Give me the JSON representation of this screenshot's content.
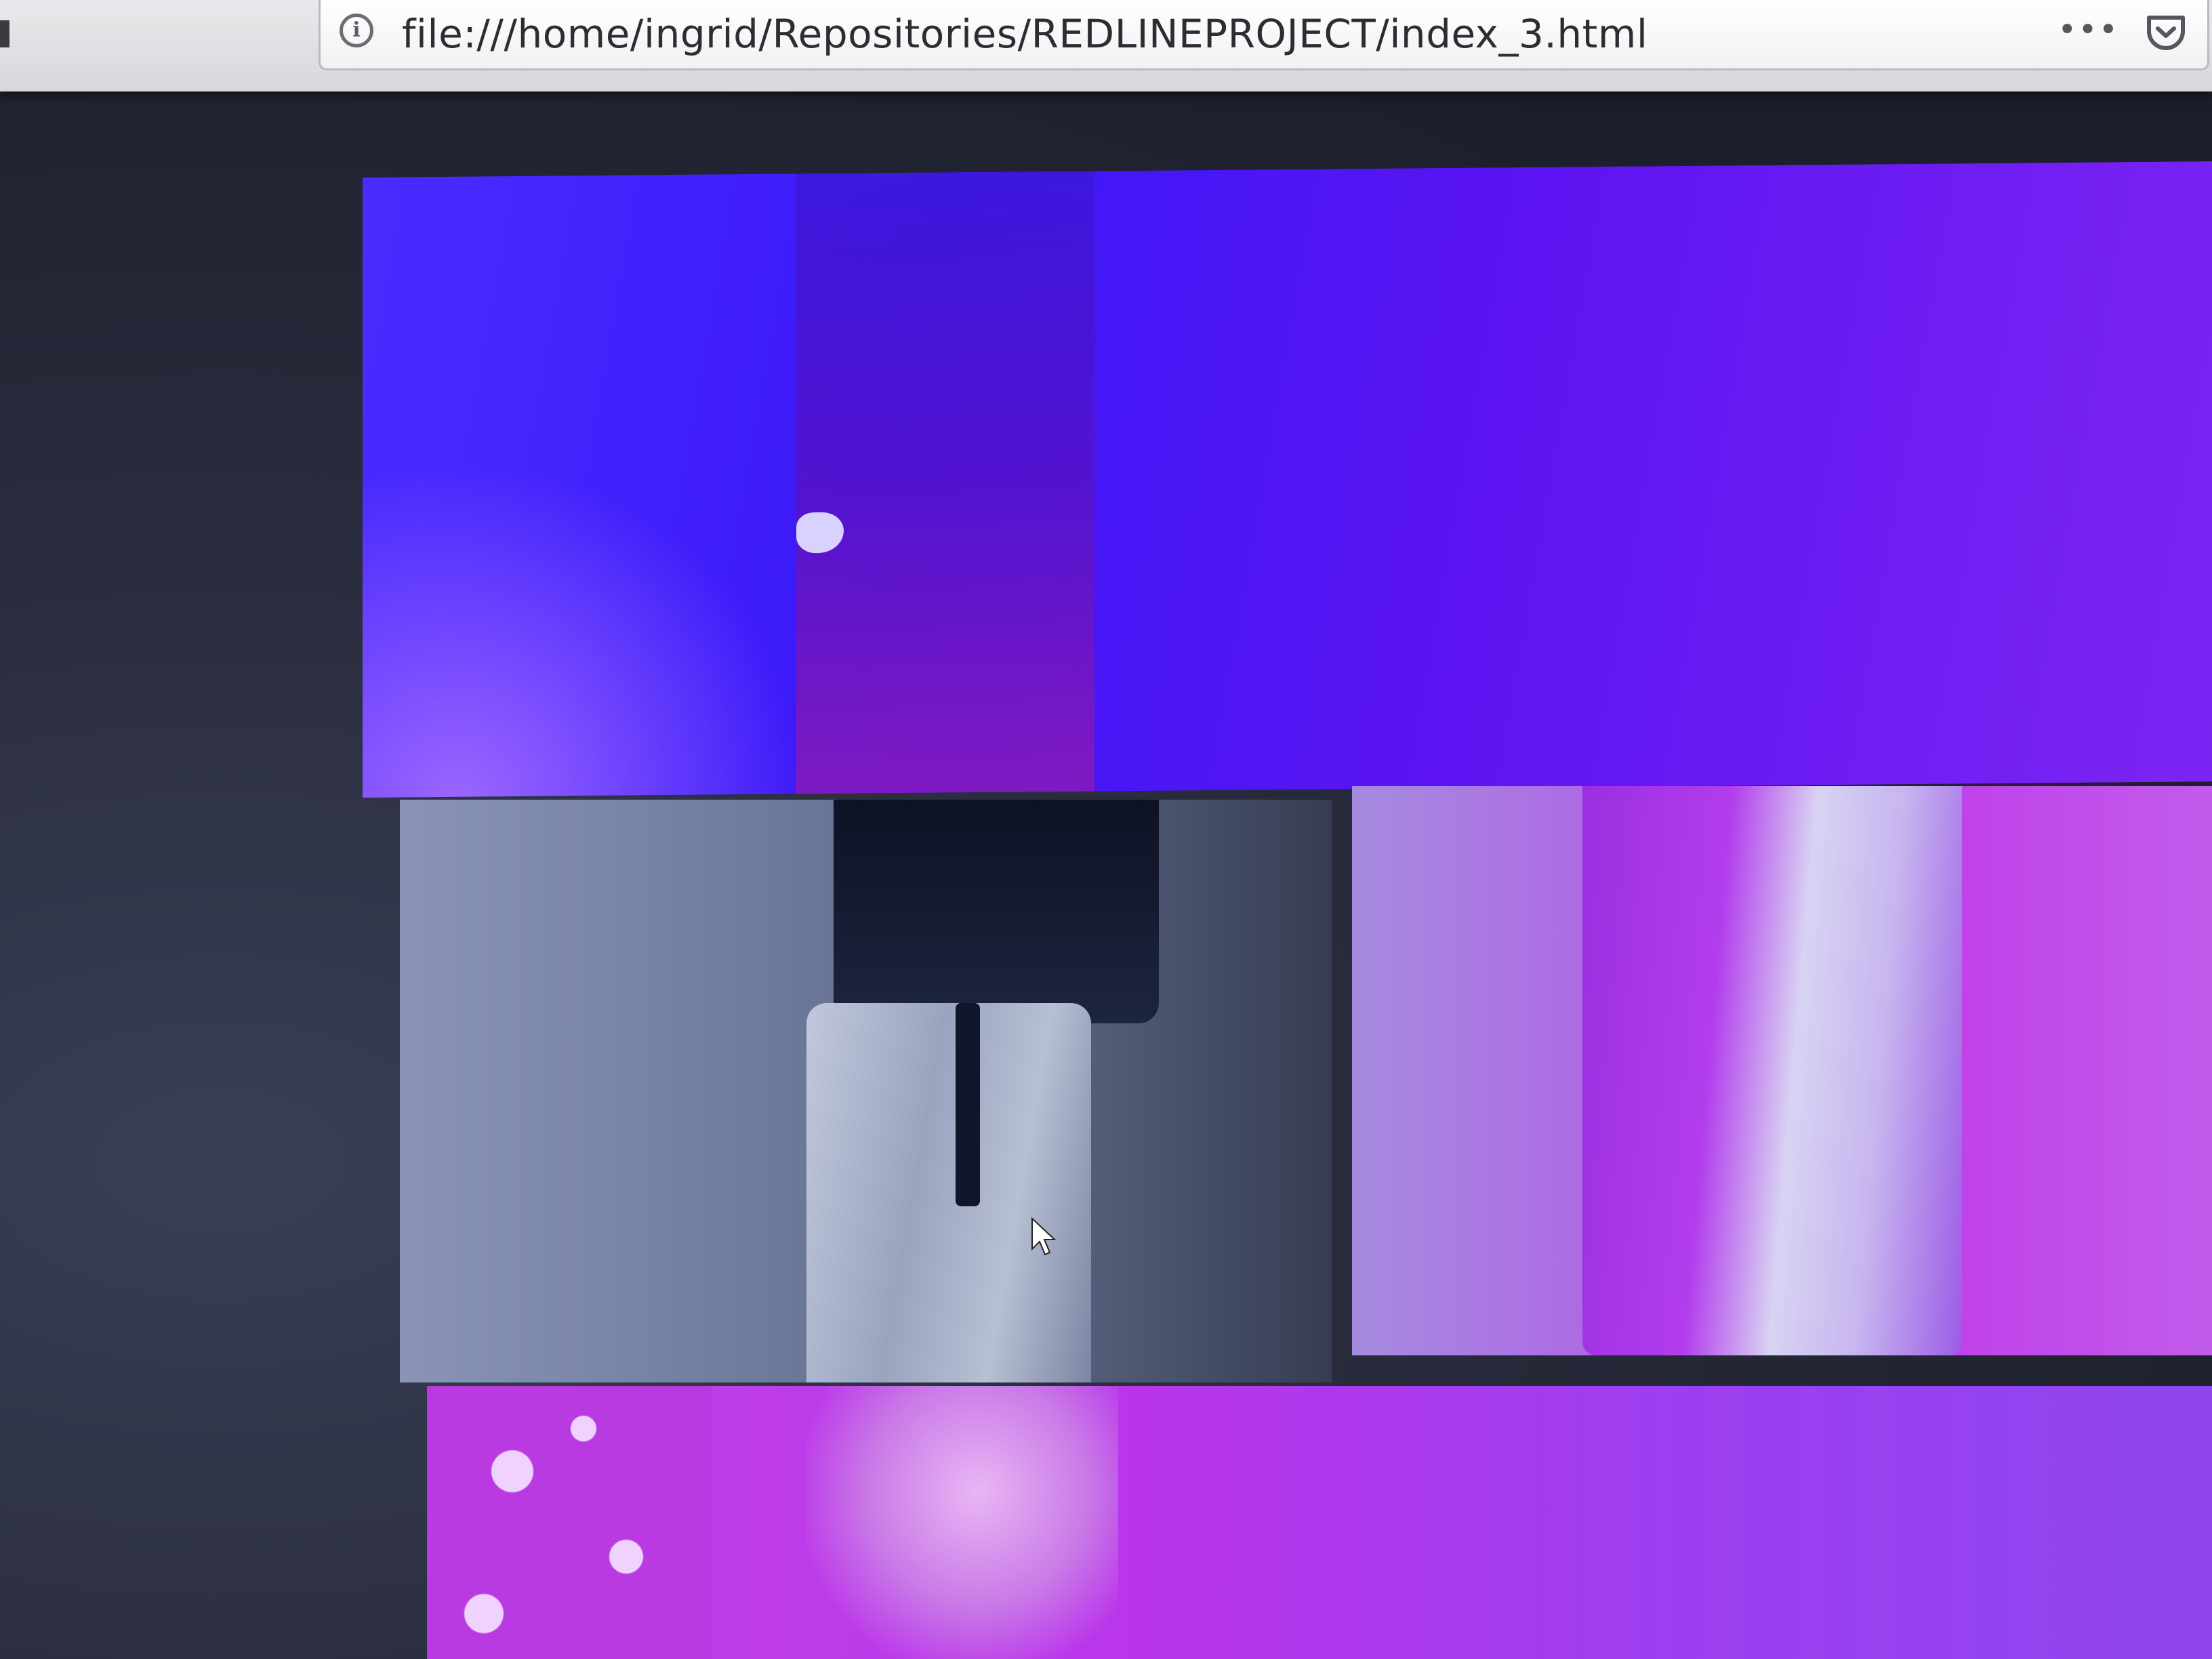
{
  "browser": {
    "url": "file:///home/ingrid/Repositories/REDLINEPROJECT/index_3.html",
    "info_icon": "i",
    "more_icon": "•••",
    "icons": [
      "info-icon",
      "more-actions-icon",
      "pocket-icon",
      "cursor-icon"
    ]
  },
  "gallery": {
    "photos": [
      {
        "name": "photo-top"
      },
      {
        "name": "photo-mid-left"
      },
      {
        "name": "photo-mid-right"
      },
      {
        "name": "photo-bottom"
      }
    ]
  },
  "colors": {
    "page_background": "#1f2130",
    "accent_blue": "#3a18f8",
    "accent_purple": "#b935ea"
  }
}
